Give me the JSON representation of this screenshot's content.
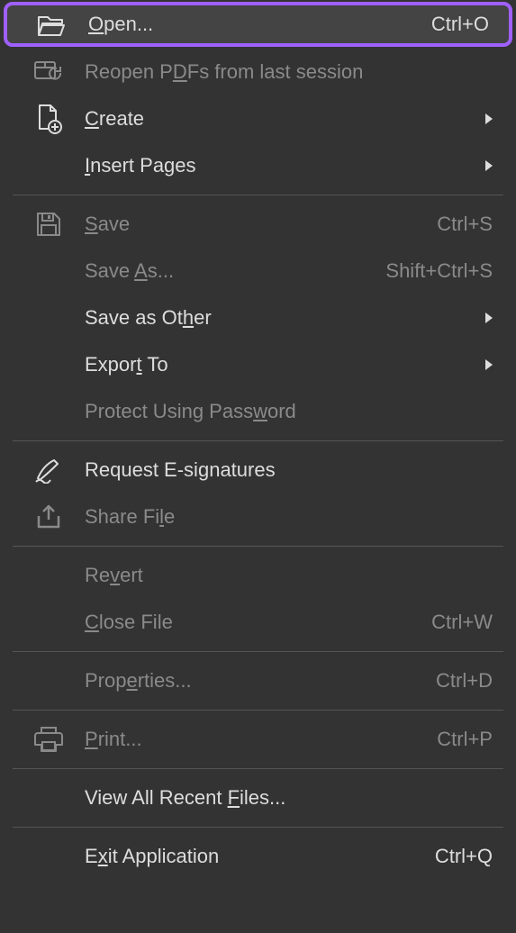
{
  "menu": {
    "open": {
      "label_pre": "",
      "u": "O",
      "label_post": "pen...",
      "shortcut": "Ctrl+O"
    },
    "reopen": {
      "label_pre": "Reopen P",
      "u": "D",
      "label_post": "Fs from last session"
    },
    "create": {
      "label_pre": "",
      "u": "C",
      "label_post": "reate"
    },
    "insertpages": {
      "label_pre": "",
      "u": "I",
      "label_post": "nsert Pages"
    },
    "save": {
      "label_pre": "",
      "u": "S",
      "label_post": "ave",
      "shortcut": "Ctrl+S"
    },
    "saveas": {
      "label_pre": "Save ",
      "u": "A",
      "label_post": "s...",
      "shortcut": "Shift+Ctrl+S"
    },
    "saveother": {
      "label_pre": "Save as Ot",
      "u": "h",
      "label_post": "er"
    },
    "exportto": {
      "label_pre": "Expor",
      "u": "t",
      "label_post": " To"
    },
    "protect": {
      "label_pre": "Protect Using Pass",
      "u": "w",
      "label_post": "ord"
    },
    "reqsign": {
      "label_pre": "Request E-si",
      "u": "g",
      "label_post": "natures"
    },
    "sharefile": {
      "label_pre": "Share Fi",
      "u": "l",
      "label_post": "e"
    },
    "revert": {
      "label_pre": "Re",
      "u": "v",
      "label_post": "ert"
    },
    "closefile": {
      "label_pre": "",
      "u": "C",
      "label_post": "lose File",
      "shortcut": "Ctrl+W"
    },
    "properties": {
      "label_pre": "Prop",
      "u": "e",
      "label_post": "rties...",
      "shortcut": "Ctrl+D"
    },
    "print": {
      "label_pre": "",
      "u": "P",
      "label_post": "rint...",
      "shortcut": "Ctrl+P"
    },
    "viewrecent": {
      "label_pre": "View All Recent ",
      "u": "F",
      "label_post": "iles..."
    },
    "exit": {
      "label_pre": "E",
      "u": "x",
      "label_post": "it Application",
      "shortcut": "Ctrl+Q"
    }
  }
}
